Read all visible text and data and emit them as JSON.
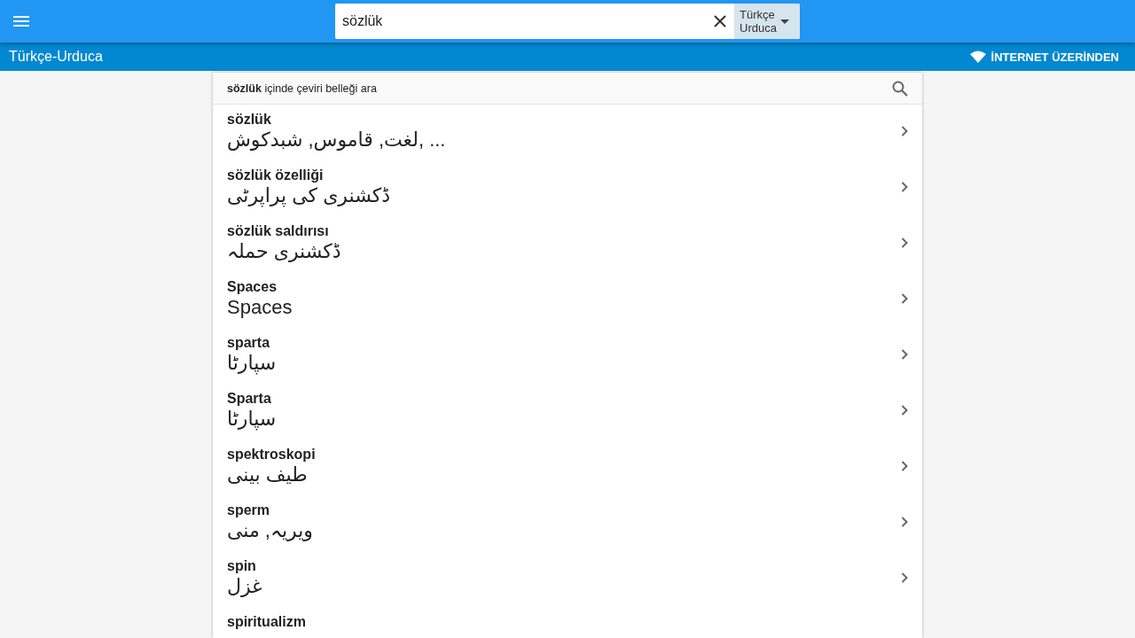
{
  "app_bar": {
    "search": {
      "value": "sözlük"
    },
    "language_pair": "Türkçe\nUrduca"
  },
  "sub_bar": {
    "title": "Türkçe-Urduca",
    "status": "İNTERNET ÜZERİNDEN"
  },
  "memory_search": {
    "hint": "**sözlük** içinde çeviri belleği ara"
  },
  "results": [
    {
      "term": "sözlük",
      "translation": "لغت, قاموس, شبدکوش, ..."
    },
    {
      "term": "sözlük özelliği",
      "translation": "ڈکشنری کی پراپرٹی"
    },
    {
      "term": "sözlük saldırısı",
      "translation": "ڈکشنری حملہ"
    },
    {
      "term": "Spaces",
      "translation": "Spaces"
    },
    {
      "term": "sparta",
      "translation": "سپارٹا"
    },
    {
      "term": "Sparta",
      "translation": "سپارٹا"
    },
    {
      "term": "spektroskopi",
      "translation": "طیف بینی"
    },
    {
      "term": "sperm",
      "translation": "ویریہ, منی"
    },
    {
      "term": "spin",
      "translation": "غزل"
    },
    {
      "term": "spiritualizm"
    }
  ]
}
